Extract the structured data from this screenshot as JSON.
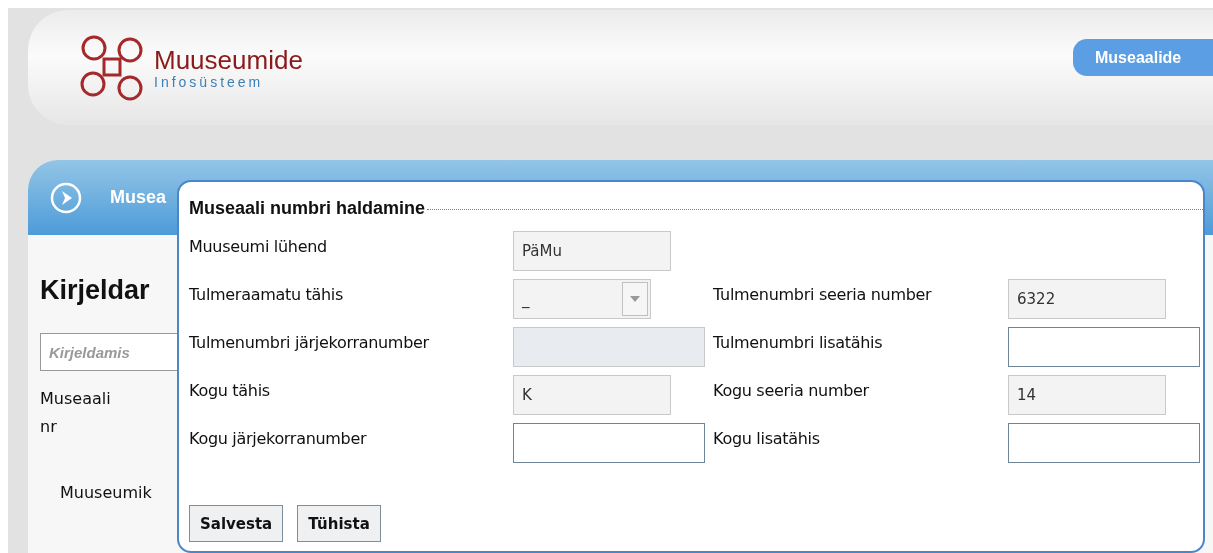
{
  "header": {
    "logo_title": "Muuseumide",
    "logo_subtitle": "Infosüsteem",
    "nav_button": "Museaalide"
  },
  "panel": {
    "title": "Musea",
    "heading": "Kirjeldar",
    "search": {
      "placeholder": "Kirjeldamis"
    },
    "label": "Museaali nr",
    "label_2": "Muuseumik"
  },
  "dialog": {
    "title": "Museaali numbri haldamine",
    "rows": [
      [
        {
          "label": "Muuseumi lühend",
          "kind": "readonly",
          "value": "PäMu"
        }
      ],
      [
        {
          "label": "Tulmeraamatu tähis",
          "kind": "select",
          "value": "_"
        },
        {
          "label": "Tulmenumbri seeria number",
          "kind": "readonly",
          "value": "6322"
        }
      ],
      [
        {
          "label": "Tulmenumbri järjekorranumber",
          "kind": "disabled"
        },
        {
          "label": "Tulmenumbri lisatähis",
          "kind": "text"
        }
      ],
      [
        {
          "label": "Kogu tähis",
          "kind": "readonly",
          "value": "K"
        },
        {
          "label": "Kogu seeria number",
          "kind": "readonly",
          "value": "14"
        }
      ],
      [
        {
          "label": "Kogu järjekorranumber",
          "kind": "text"
        },
        {
          "label": "Kogu lisatähis",
          "kind": "text"
        }
      ]
    ],
    "buttons": [
      "Salvesta",
      "Tühista"
    ]
  }
}
